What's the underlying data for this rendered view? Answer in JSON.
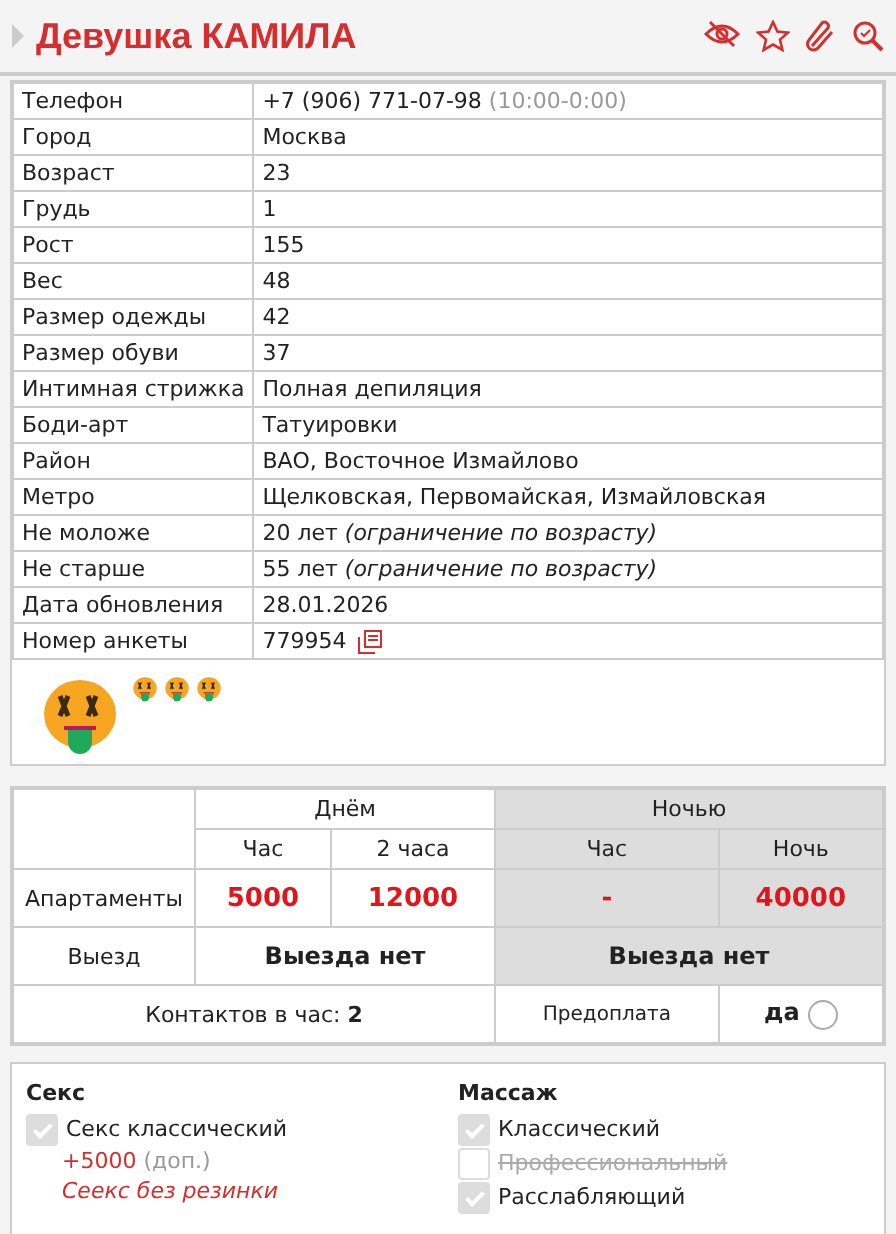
{
  "header": {
    "title": "Девушка КАМИЛА"
  },
  "info": [
    {
      "label": "Телефон",
      "value": "+7 (906) 771-07-98",
      "note": "(10:00-0:00)",
      "kind": "phone"
    },
    {
      "label": "Город",
      "value": "Москва",
      "kind": "plain"
    },
    {
      "label": "Возраст",
      "value": "23",
      "kind": "plain"
    },
    {
      "label": "Грудь",
      "value": "1",
      "kind": "plain"
    },
    {
      "label": "Рост",
      "value": "155",
      "kind": "plain"
    },
    {
      "label": "Вес",
      "value": "48",
      "kind": "plain"
    },
    {
      "label": "Размер одежды",
      "value": "42",
      "kind": "plain"
    },
    {
      "label": "Размер обуви",
      "value": "37",
      "kind": "plain"
    },
    {
      "label": "Интимная стрижка",
      "value": "Полная депиляция",
      "kind": "plain"
    },
    {
      "label": "Боди-арт",
      "value": "Татуировки",
      "kind": "plain"
    },
    {
      "label": "Район",
      "value": "ВАО, Восточное Измайлово",
      "kind": "plain"
    },
    {
      "label": "Метро",
      "value": "Щелковская, Первомайская, Измайловская",
      "kind": "plain"
    },
    {
      "label": "Не моложе",
      "value": "20 лет",
      "note": "(ограничение по возрасту)",
      "kind": "limit"
    },
    {
      "label": "Не старше",
      "value": "55 лет",
      "note": "(ограничение по возрасту)",
      "kind": "limit"
    },
    {
      "label": "Дата обновления",
      "value": "28.01.2026",
      "kind": "plain"
    },
    {
      "label": "Номер анкеты",
      "value": "779954",
      "kind": "id"
    }
  ],
  "prices": {
    "day": "Днём",
    "night": "Ночью",
    "columns": [
      "Час",
      "2 часа",
      "Час",
      "Ночь"
    ],
    "apartments": {
      "label": "Апартаменты",
      "values": [
        "5000",
        "12000",
        "-",
        "40000"
      ]
    },
    "outcall": {
      "label": "Выезд",
      "day": "Выезда нет",
      "night": "Выезда нет"
    },
    "contacts_label": "Контактов в час:",
    "contacts": "2",
    "prepay_label": "Предоплата",
    "prepay": "да"
  },
  "services": [
    {
      "title": "Секс",
      "items": [
        {
          "label": "Секс классический",
          "checked": true,
          "extra": "+5000",
          "extra_note": "(доп.)",
          "remark": "Сеекс без резинки"
        }
      ]
    },
    {
      "title": "Массаж",
      "items": [
        {
          "label": "Классический",
          "checked": true
        },
        {
          "label": "Профессиональный",
          "checked": false
        },
        {
          "label": "Расслабляющий",
          "checked": true
        }
      ]
    }
  ]
}
